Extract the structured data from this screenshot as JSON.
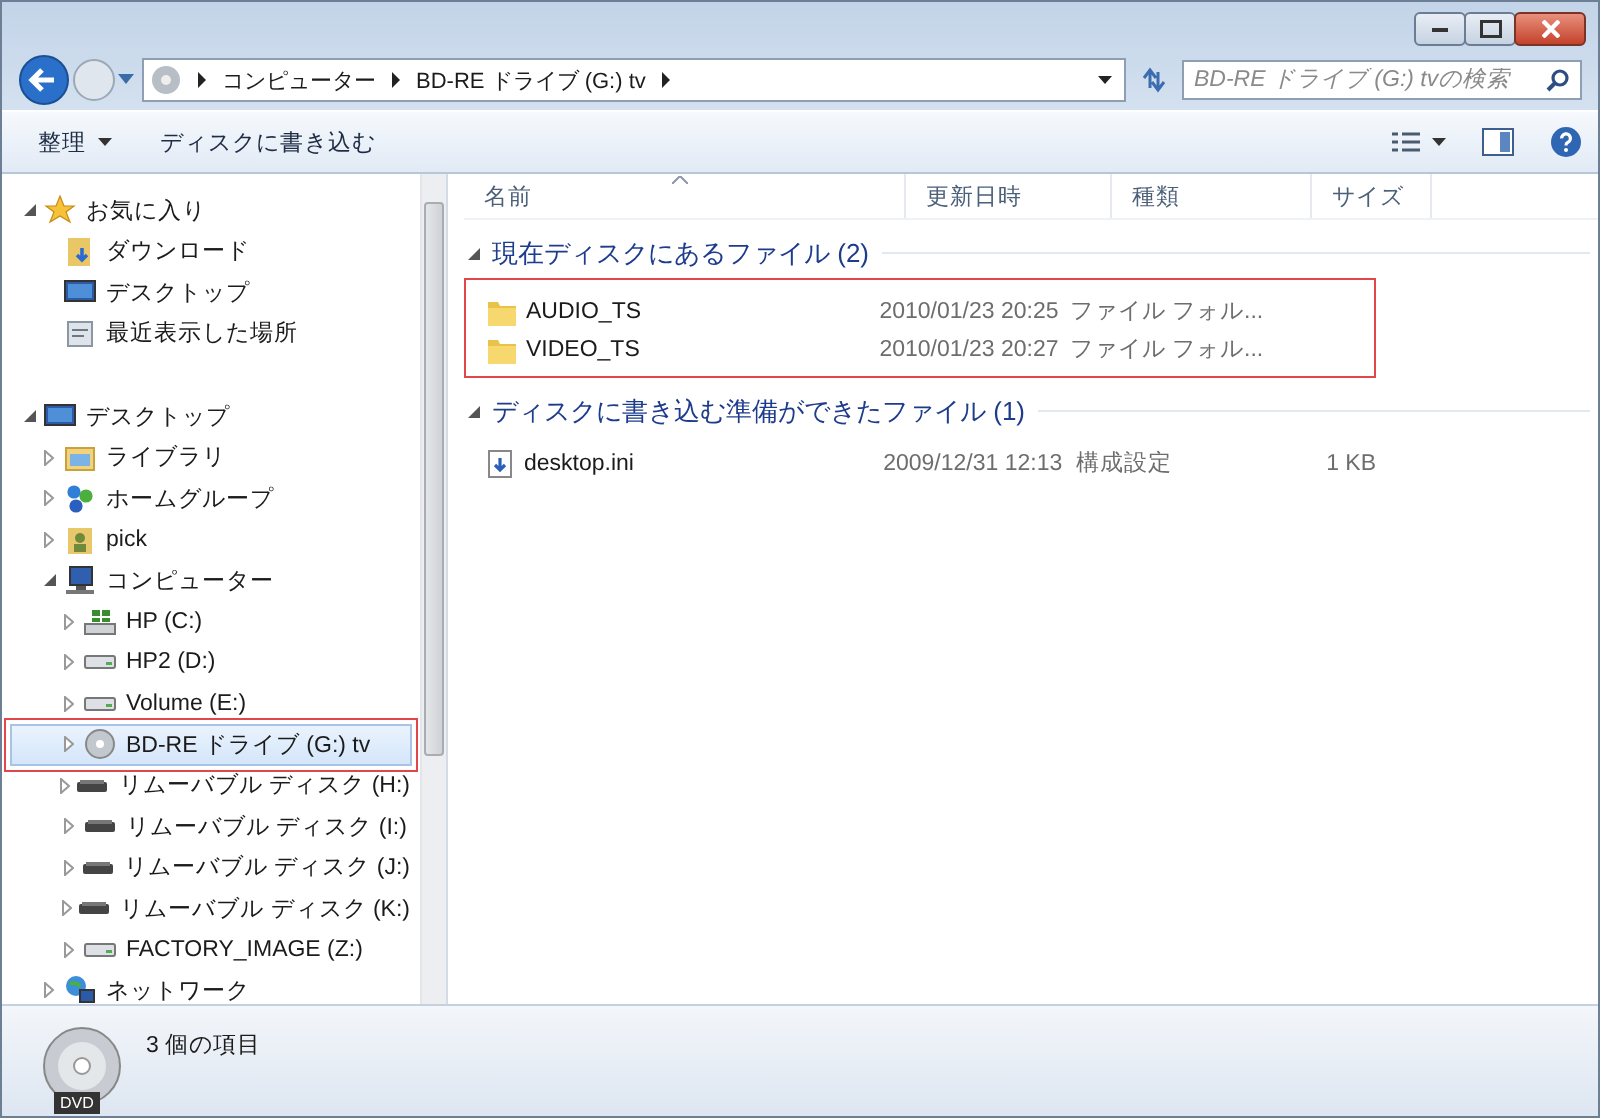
{
  "address_bar": {
    "breadcrumbs": [
      "コンピューター",
      "BD-RE ドライブ (G:) tv"
    ]
  },
  "search": {
    "placeholder": "BD-RE ドライブ (G:) tvの検索"
  },
  "toolbar": {
    "buttons": [
      {
        "label": "整理",
        "dropdown": true
      },
      {
        "label": "ディスクに書き込む",
        "dropdown": false
      }
    ]
  },
  "navigation": {
    "items": [
      {
        "label": "お気に入り",
        "kind": "favorites",
        "expanded": true,
        "selected": false,
        "highlighted": false,
        "children": [
          {
            "label": "ダウンロード",
            "kind": "downloads",
            "selected": false,
            "highlighted": false
          },
          {
            "label": "デスクトップ",
            "kind": "desktop",
            "selected": false,
            "highlighted": false
          },
          {
            "label": "最近表示した場所",
            "kind": "recent",
            "selected": false,
            "highlighted": false
          }
        ]
      },
      {
        "label": "デスクトップ",
        "kind": "desktop",
        "expanded": true,
        "selected": false,
        "highlighted": false,
        "children": [
          {
            "label": "ライブラリ",
            "kind": "library",
            "expanded": false,
            "selected": false,
            "highlighted": false
          },
          {
            "label": "ホームグループ",
            "kind": "homegroup",
            "expanded": false,
            "selected": false,
            "highlighted": false
          },
          {
            "label": "pick",
            "kind": "user",
            "expanded": false,
            "selected": false,
            "highlighted": false
          },
          {
            "label": "コンピューター",
            "kind": "computer",
            "expanded": true,
            "selected": false,
            "highlighted": false,
            "children": [
              {
                "label": "HP (C:)",
                "kind": "system-drive",
                "expanded": false,
                "selected": false,
                "highlighted": false
              },
              {
                "label": "HP2 (D:)",
                "kind": "drive",
                "expanded": false,
                "selected": false,
                "highlighted": false
              },
              {
                "label": "Volume (E:)",
                "kind": "drive",
                "expanded": false,
                "selected": false,
                "highlighted": false
              },
              {
                "label": "BD-RE ドライブ (G:) tv",
                "kind": "disc",
                "expanded": false,
                "selected": true,
                "highlighted": true
              },
              {
                "label": "リムーバブル ディスク (H:)",
                "kind": "removable",
                "expanded": false,
                "selected": false,
                "highlighted": false
              },
              {
                "label": "リムーバブル ディスク (I:)",
                "kind": "removable",
                "expanded": false,
                "selected": false,
                "highlighted": false
              },
              {
                "label": "リムーバブル ディスク (J:)",
                "kind": "removable",
                "expanded": false,
                "selected": false,
                "highlighted": false
              },
              {
                "label": "リムーバブル ディスク (K:)",
                "kind": "removable",
                "expanded": false,
                "selected": false,
                "highlighted": false
              },
              {
                "label": "FACTORY_IMAGE (Z:)",
                "kind": "drive",
                "expanded": false,
                "selected": false,
                "highlighted": false
              }
            ]
          },
          {
            "label": "ネットワーク",
            "kind": "network",
            "expanded": false,
            "selected": false,
            "highlighted": false
          }
        ]
      }
    ]
  },
  "file_list": {
    "columns": [
      "名前",
      "更新日時",
      "種類",
      "サイズ"
    ],
    "groups": [
      {
        "title": "現在ディスクにあるファイル (2)",
        "expanded": true,
        "highlighted": true,
        "files": [
          {
            "name": "AUDIO_TS",
            "kind": "folder",
            "modified": "2010/01/23 20:25",
            "type": "ファイル フォル..."
          },
          {
            "name": "VIDEO_TS",
            "kind": "folder",
            "modified": "2010/01/23 20:27",
            "type": "ファイル フォル..."
          }
        ]
      },
      {
        "title": "ディスクに書き込む準備ができたファイル (1)",
        "expanded": true,
        "highlighted": false,
        "files": [
          {
            "name": "desktop.ini",
            "kind": "settings-file",
            "modified": "2009/12/31 12:13",
            "type": "構成設定",
            "size": "1 KB"
          }
        ]
      }
    ]
  },
  "status_bar": {
    "text": "3 個の項目",
    "disc_label": "DVD"
  }
}
